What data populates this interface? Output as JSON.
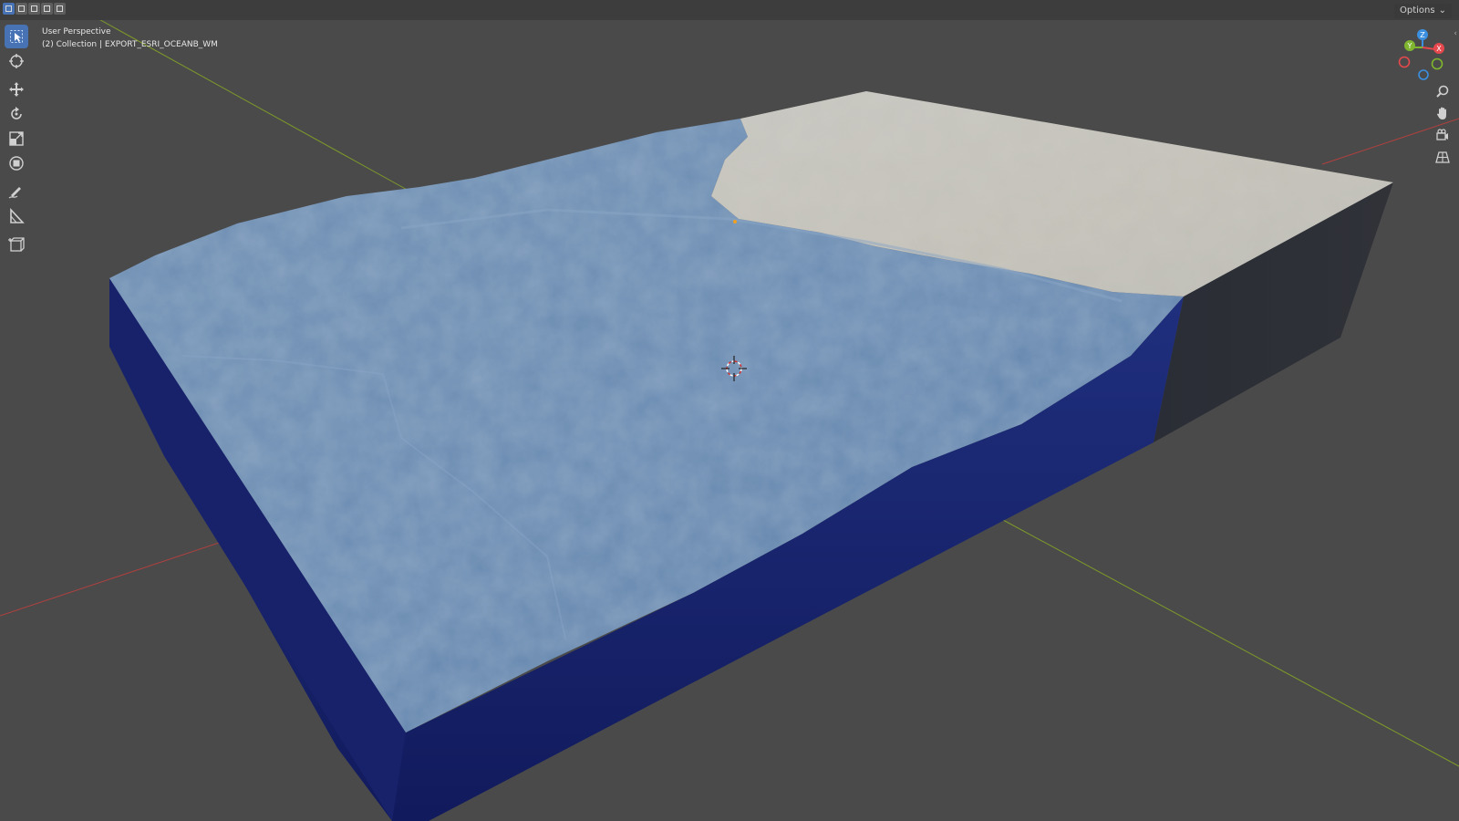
{
  "viewport": {
    "view_name": "User Perspective",
    "collection_info": "(2) Collection | EXPORT_ESRI_OCEANB_WM"
  },
  "header": {
    "options_label": "Options",
    "selection_modes": [
      "set-selection",
      "extend-selection",
      "subtract-selection",
      "invert-selection",
      "intersect-selection"
    ]
  },
  "toolbar": {
    "tools": [
      "select-box",
      "cursor",
      "move",
      "rotate",
      "scale",
      "transform",
      "annotate",
      "measure",
      "add-cube"
    ],
    "active_tool": "select-box"
  },
  "navigation": {
    "buttons": [
      "zoom",
      "pan",
      "camera-view",
      "perspective-toggle"
    ]
  },
  "gizmo": {
    "axes": [
      "X",
      "Y",
      "Z"
    ],
    "colors": {
      "x": "#e5484d",
      "y": "#7fb52f",
      "z": "#3b8fe0"
    }
  },
  "scene": {
    "ocean_color": "#1c2a8c",
    "terrain_color": "#6f8fb3",
    "land_color": "#c9c7c0",
    "background": "#4a4a4a"
  }
}
